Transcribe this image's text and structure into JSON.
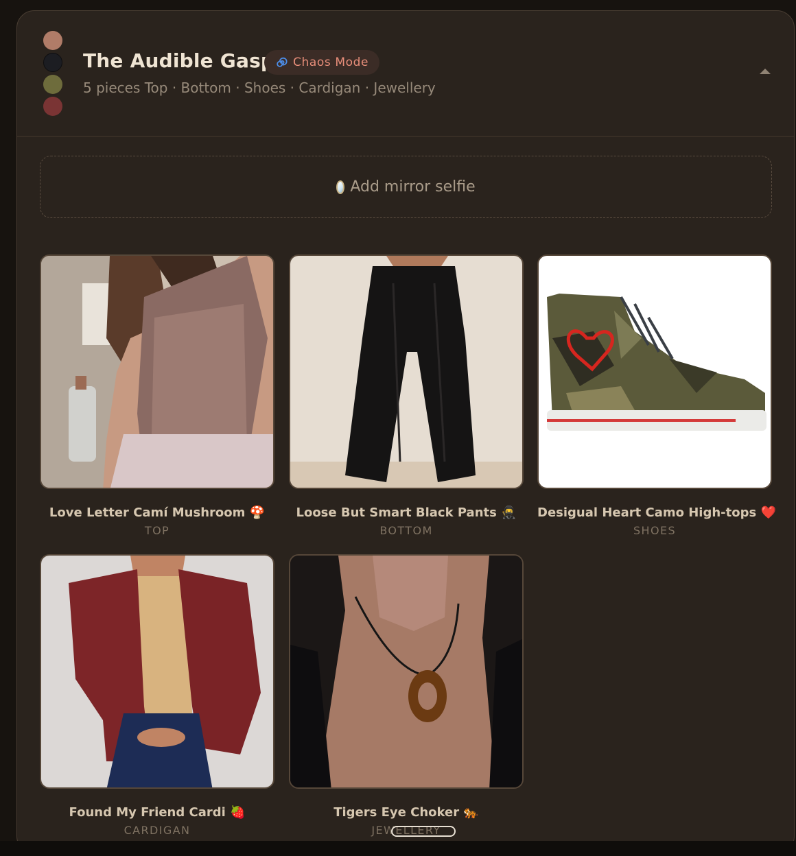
{
  "outfit": {
    "title": "The Audible Gasp",
    "mode_badge": "Chaos Mode",
    "mode_icon": "spiral-icon",
    "subtitle": "5 pieces Top · Bottom · Shoes · Cardigan · Jewellery",
    "palette": [
      "#b07c68",
      "#1c1d22",
      "#6e6c3c",
      "#7a3434"
    ]
  },
  "selfie": {
    "label": "Add mirror selfie",
    "icon": "mirror-icon"
  },
  "items": [
    {
      "name": "Love Letter Camí Mushroom 🍄",
      "category": "TOP"
    },
    {
      "name": "Loose But Smart Black Pants 🥷",
      "category": "BOTTOM"
    },
    {
      "name": "Desigual Heart Camo High-tops ❤️",
      "category": "SHOES"
    },
    {
      "name": "Found My Friend Cardi 🍓",
      "category": "CARDIGAN"
    },
    {
      "name": "Tigers Eye Choker 🐅",
      "category": "JEWELLERY"
    }
  ],
  "colors": {
    "title": "#efe4d3",
    "badge_text": "#e88e7a",
    "card_bg": "#2a231d"
  }
}
